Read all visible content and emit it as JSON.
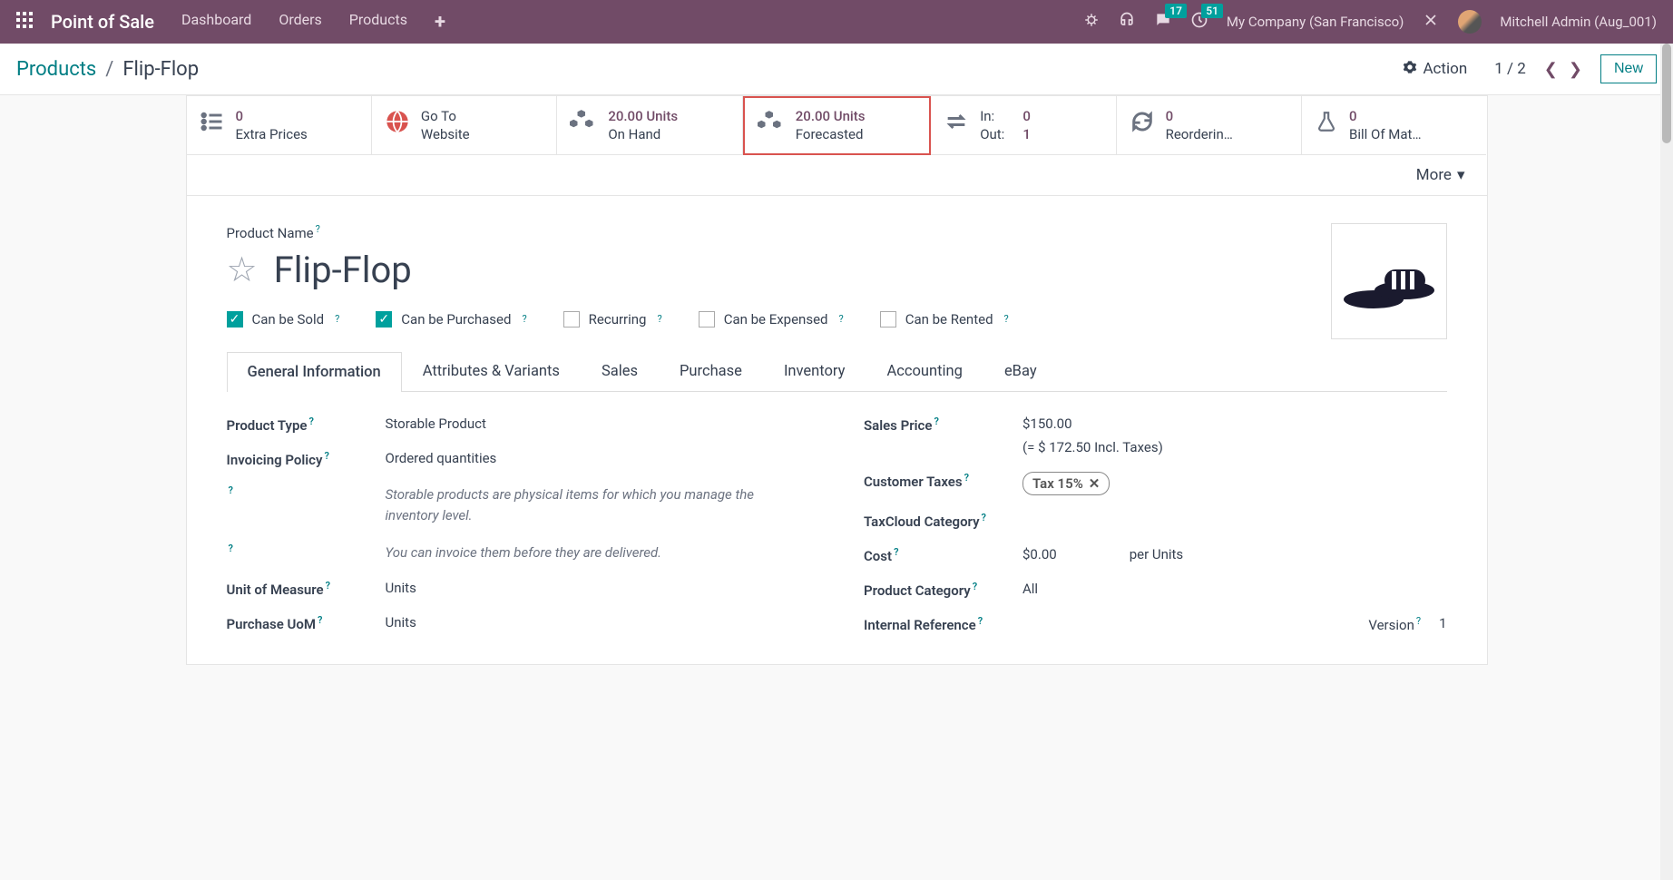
{
  "topnav": {
    "brand": "Point of Sale",
    "menu": [
      "Dashboard",
      "Orders",
      "Products"
    ],
    "chat_badge": "17",
    "activity_badge": "51",
    "company": "My Company (San Francisco)",
    "user": "Mitchell Admin (Aug_001)"
  },
  "control": {
    "breadcrumb_parent": "Products",
    "breadcrumb_current": "Flip-Flop",
    "action_label": "Action",
    "pager_current": "1",
    "pager_total": "2",
    "new_label": "New"
  },
  "stats": {
    "extra_prices": {
      "value": "0",
      "label": "Extra Prices"
    },
    "goto_website": {
      "value": "Go To",
      "label": "Website"
    },
    "on_hand": {
      "value": "20.00 Units",
      "label": "On Hand"
    },
    "forecasted": {
      "value": "20.00 Units",
      "label": "Forecasted"
    },
    "inout": {
      "in_label": "In:",
      "in_val": "0",
      "out_label": "Out:",
      "out_val": "1"
    },
    "reordering": {
      "value": "0",
      "label": "Reorderin…"
    },
    "bom": {
      "value": "0",
      "label": "Bill Of Mat…"
    }
  },
  "more_label": "More",
  "product": {
    "name_label": "Product Name",
    "name": "Flip-Flop",
    "checks": {
      "sold": "Can be Sold",
      "purchased": "Can be Purchased",
      "recurring": "Recurring",
      "expensed": "Can be Expensed",
      "rented": "Can be Rented"
    }
  },
  "tabs": [
    "General Information",
    "Attributes & Variants",
    "Sales",
    "Purchase",
    "Inventory",
    "Accounting",
    "eBay"
  ],
  "fields": {
    "product_type_label": "Product Type",
    "product_type_value": "Storable Product",
    "invoicing_policy_label": "Invoicing Policy",
    "invoicing_policy_value": "Ordered quantities",
    "hint1": "Storable products are physical items for which you manage the inventory level.",
    "hint2": "You can invoice them before they are delivered.",
    "uom_label": "Unit of Measure",
    "uom_value": "Units",
    "purchase_uom_label": "Purchase UoM",
    "purchase_uom_value": "Units",
    "sales_price_label": "Sales Price",
    "sales_price_value": "$150.00",
    "incl_taxes": "(= $ 172.50 Incl. Taxes)",
    "customer_taxes_label": "Customer Taxes",
    "tax_tag": "Tax 15%",
    "taxcloud_label": "TaxCloud Category",
    "cost_label": "Cost",
    "cost_value": "$0.00",
    "cost_per": "per Units",
    "category_label": "Product Category",
    "category_value": "All",
    "internal_ref_label": "Internal Reference",
    "version_label": "Version",
    "version_value": "1"
  }
}
